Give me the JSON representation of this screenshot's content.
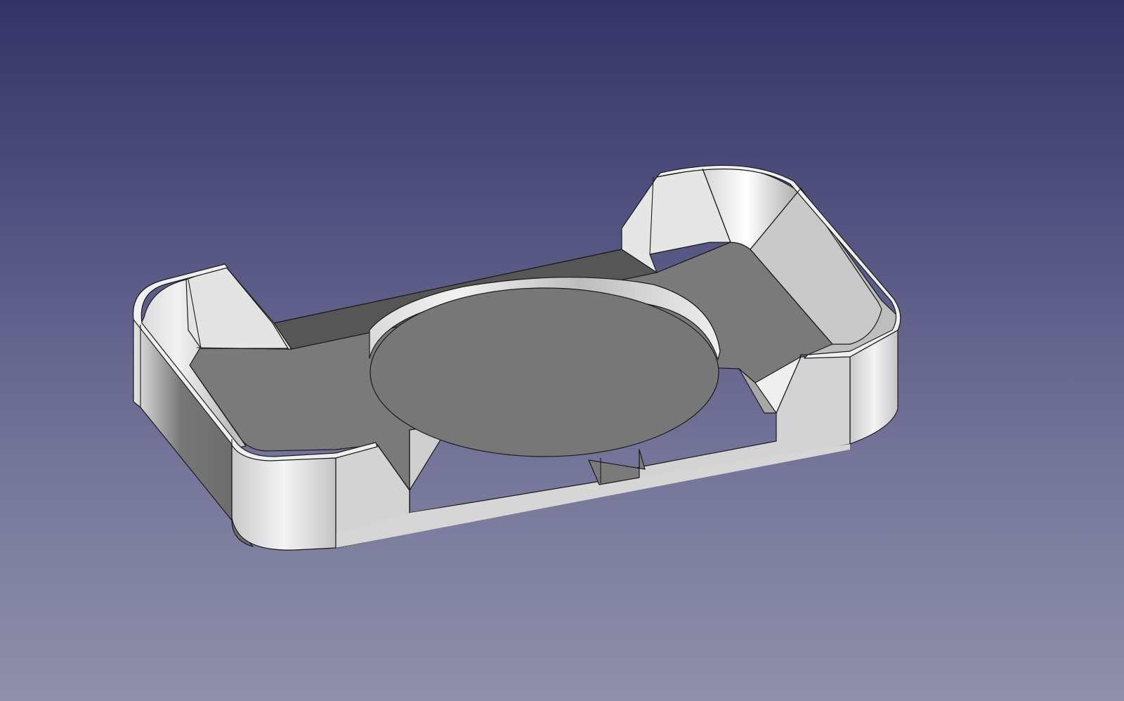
{
  "viewport": {
    "name": "3D view",
    "background_top": "#333366",
    "background_bottom": "#9090ab"
  },
  "model": {
    "description_visible": false,
    "face_color": "#cccccc",
    "edge_color": "#1a1a1a"
  }
}
